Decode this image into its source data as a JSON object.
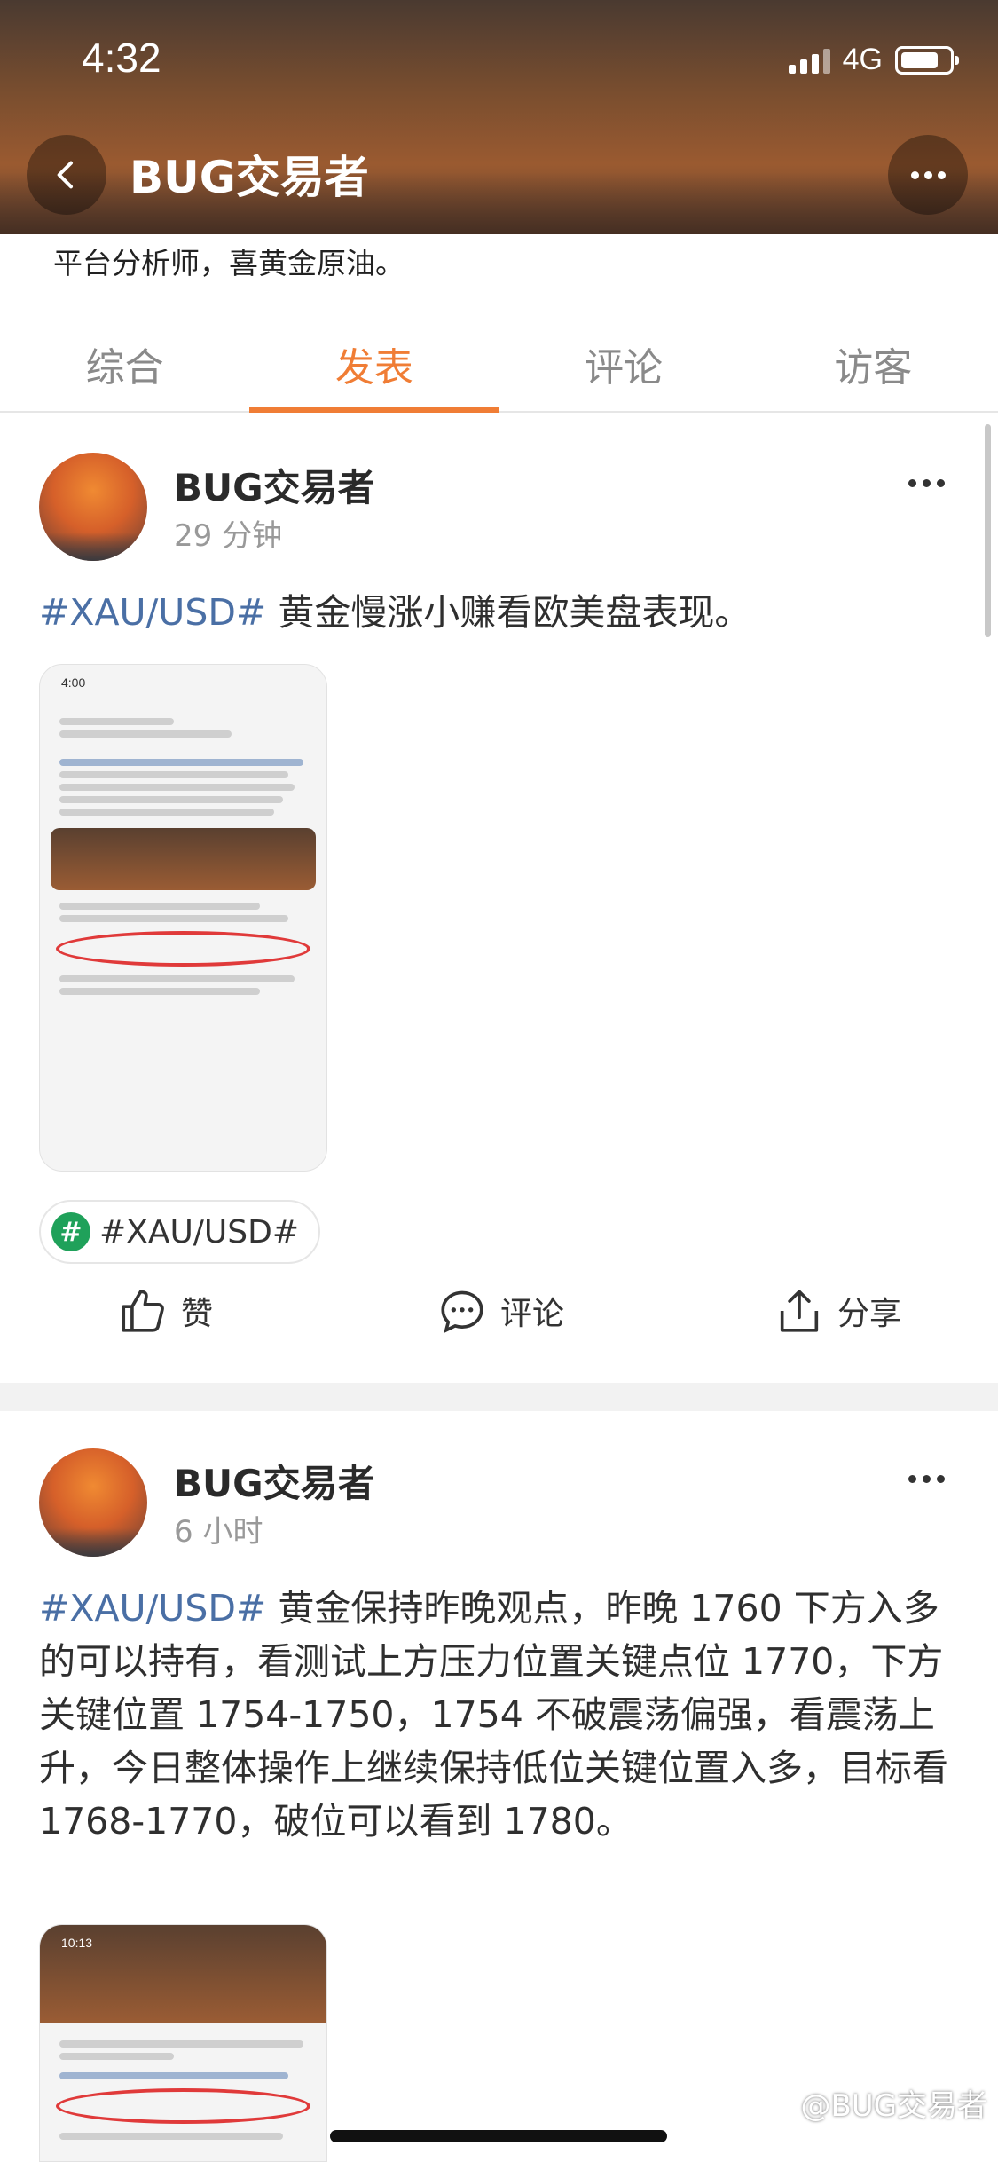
{
  "status_bar": {
    "time": "4:32",
    "network": "4G"
  },
  "header": {
    "title": "BUG交易者",
    "bio": "平台分析师，喜黄金原油。"
  },
  "tabs": [
    {
      "label": "综合",
      "active": false
    },
    {
      "label": "发表",
      "active": true
    },
    {
      "label": "评论",
      "active": false
    },
    {
      "label": "访客",
      "active": false
    }
  ],
  "posts": [
    {
      "author": "BUG交易者",
      "time": "29 分钟",
      "hashtag": "#XAU/USD#",
      "body": " 黄金慢涨小赚看欧美盘表现。",
      "topic_pill": "#XAU/USD#",
      "actions": {
        "like": "赞",
        "comment": "评论",
        "share": "分享"
      },
      "thumb_time": "4:00"
    },
    {
      "author": "BUG交易者",
      "time": "6 小时",
      "hashtag": "#XAU/USD#",
      "body": " 黄金保持昨晚观点，昨晚 1760 下方入多的可以持有，看测试上方压力位置关键点位 1770，下方关键位置 1754-1750，1754 不破震荡偏强，看震荡上升，今日整体操作上继续保持低位关键位置入多，目标看 1768-1770，破位可以看到 1780。",
      "thumb_time": "10:13"
    }
  ],
  "watermark": "@BUG交易者",
  "colors": {
    "accent": "#f07d35",
    "hashtag": "#4a6fa5",
    "topic_icon": "#1fa15a"
  }
}
